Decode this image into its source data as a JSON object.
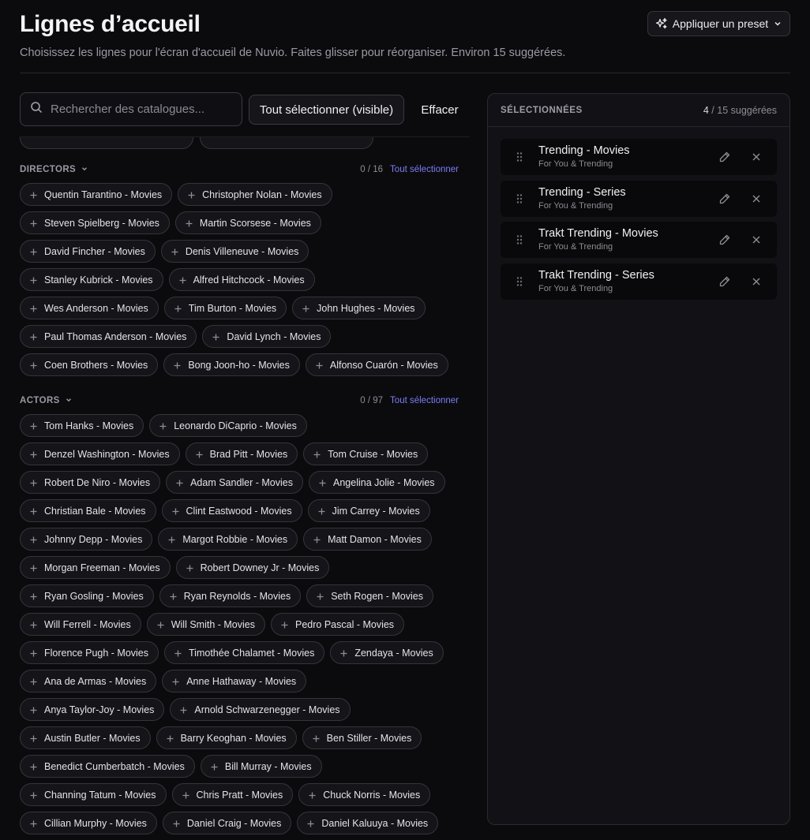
{
  "header": {
    "title": "Lignes d’accueil",
    "subtitle": "Choisissez les lignes pour l'écran d'accueil de Nuvio. Faites glisser pour réorganiser. Environ 15 suggérées.",
    "preset_label": "Appliquer un preset"
  },
  "toolbar": {
    "search_placeholder": "Rechercher des catalogues...",
    "select_all_label": "Tout sélectionner (visible)",
    "clear_label": "Effacer"
  },
  "sections": [
    {
      "title": "DIRECTORS",
      "count": "0 / 16",
      "select_all": "Tout sélectionner",
      "rows": [
        [
          "Quentin Tarantino - Movies",
          "Christopher Nolan - Movies"
        ],
        [
          "Steven Spielberg - Movies",
          "Martin Scorsese - Movies"
        ],
        [
          "David Fincher - Movies",
          "Denis Villeneuve - Movies"
        ],
        [
          "Stanley Kubrick - Movies",
          "Alfred Hitchcock - Movies"
        ],
        [
          "Wes Anderson - Movies",
          "Tim Burton - Movies",
          "John Hughes - Movies"
        ],
        [
          "Paul Thomas Anderson - Movies",
          "David Lynch - Movies"
        ],
        [
          "Coen Brothers - Movies",
          "Bong Joon-ho - Movies",
          "Alfonso Cuarón - Movies"
        ]
      ]
    },
    {
      "title": "ACTORS",
      "count": "0 / 97",
      "select_all": "Tout sélectionner",
      "rows": [
        [
          "Tom Hanks - Movies",
          "Leonardo DiCaprio - Movies"
        ],
        [
          "Denzel Washington - Movies",
          "Brad Pitt - Movies",
          "Tom Cruise - Movies"
        ],
        [
          "Robert De Niro - Movies",
          "Adam Sandler - Movies",
          "Angelina Jolie - Movies"
        ],
        [
          "Christian Bale - Movies",
          "Clint Eastwood - Movies",
          "Jim Carrey - Movies"
        ],
        [
          "Johnny Depp - Movies",
          "Margot Robbie - Movies",
          "Matt Damon - Movies"
        ],
        [
          "Morgan Freeman - Movies",
          "Robert Downey Jr - Movies"
        ],
        [
          "Ryan Gosling - Movies",
          "Ryan Reynolds - Movies",
          "Seth Rogen - Movies"
        ],
        [
          "Will Ferrell - Movies",
          "Will Smith - Movies",
          "Pedro Pascal - Movies"
        ],
        [
          "Florence Pugh - Movies",
          "Timothée Chalamet - Movies",
          "Zendaya - Movies"
        ],
        [
          "Ana de Armas - Movies",
          "Anne Hathaway - Movies"
        ],
        [
          "Anya Taylor-Joy - Movies",
          "Arnold Schwarzenegger - Movies"
        ],
        [
          "Austin Butler - Movies",
          "Barry Keoghan - Movies",
          "Ben Stiller - Movies"
        ],
        [
          "Benedict Cumberbatch - Movies",
          "Bill Murray - Movies"
        ],
        [
          "Channing Tatum - Movies",
          "Chris Pratt - Movies",
          "Chuck Norris - Movies"
        ],
        [
          "Cillian Murphy - Movies",
          "Daniel Craig - Movies",
          "Daniel Kaluuya - Movies"
        ]
      ]
    }
  ],
  "panel": {
    "title": "SÉLECTIONNÉES",
    "selected_count": "4",
    "suggested_suffix": "/ 15 suggérées",
    "items": [
      {
        "title": "Trending - Movies",
        "subtitle": "For You & Trending"
      },
      {
        "title": "Trending - Series",
        "subtitle": "For You & Trending"
      },
      {
        "title": "Trakt Trending - Movies",
        "subtitle": "For You & Trending"
      },
      {
        "title": "Trakt Trending - Series",
        "subtitle": "For You & Trending"
      }
    ]
  },
  "colors": {
    "background": "#0b0b0e",
    "accent_link": "#7c7cf5",
    "panel": "#121216"
  }
}
